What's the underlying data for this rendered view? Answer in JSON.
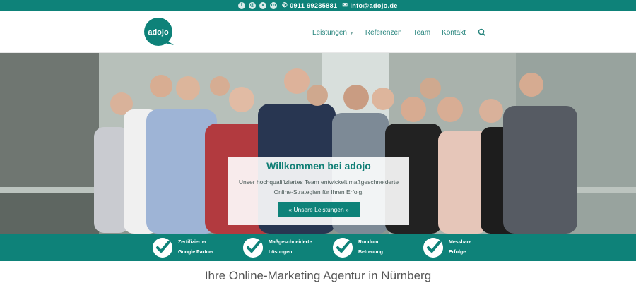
{
  "topbar": {
    "social": [
      {
        "icon": "facebook-icon",
        "glyph": "f"
      },
      {
        "icon": "instagram-icon",
        "glyph": "◎"
      },
      {
        "icon": "xing-icon",
        "glyph": "x"
      },
      {
        "icon": "linkedin-icon",
        "glyph": "in"
      }
    ],
    "phone": "0911 99285881",
    "email": "info@adojo.de"
  },
  "header": {
    "logo_text": "adojo",
    "nav": [
      {
        "label": "Leistungen",
        "has_dropdown": true
      },
      {
        "label": "Referenzen",
        "has_dropdown": false
      },
      {
        "label": "Team",
        "has_dropdown": false
      },
      {
        "label": "Kontakt",
        "has_dropdown": false
      }
    ]
  },
  "hero": {
    "title": "Willkommen bei adojo",
    "text_line1": "Unser hochqualifiziertes Team entwickelt maßgeschneiderte",
    "text_line2": "Online-Strategien für Ihren Erfolg.",
    "button_label": "« Unsere Leistungen »"
  },
  "features": [
    {
      "line1": "Zertifizierter",
      "line2": "Google Partner"
    },
    {
      "line1": "Maßgeschneiderte",
      "line2": "Lösungen"
    },
    {
      "line1": "Rundum",
      "line2": "Betreuung"
    },
    {
      "line1": "Messbare",
      "line2": "Erfolge"
    }
  ],
  "headline": "Ihre Online-Marketing Agentur in Nürnberg",
  "colors": {
    "brand": "#0e8279",
    "nav_text": "#26847c"
  }
}
